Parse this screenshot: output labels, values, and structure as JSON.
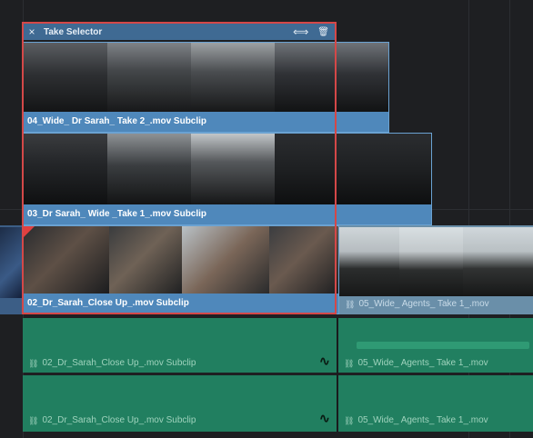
{
  "take_selector": {
    "title": "Take Selector",
    "close_glyph": "×",
    "fit_glyph": "⟺",
    "delete_glyph": "🗑",
    "accent": "#e04040"
  },
  "takes": [
    {
      "label": "04_Wide_ Dr Sarah_ Take 2_.mov Subclip"
    },
    {
      "label": "03_Dr Sarah_ Wide _Take 1_.mov Subclip"
    },
    {
      "label": "02_Dr_Sarah_Close Up_.mov Subclip"
    }
  ],
  "video_track": {
    "next_clip_label": "05_Wide_ Agents_ Take 1_.mov"
  },
  "audio_tracks": [
    {
      "left_label": "02_Dr_Sarah_Close Up_.mov Subclip",
      "right_label": "05_Wide_ Agents_ Take 1_.mov"
    },
    {
      "left_label": "02_Dr_Sarah_Close Up_.mov Subclip",
      "right_label": "05_Wide_ Agents_ Take 1_.mov"
    }
  ],
  "icons": {
    "link_glyph": "⛓",
    "waveform_glyph": "∿"
  },
  "colors": {
    "selected_clip": "#4a80b2",
    "audio": "#217f60",
    "background": "#1e1f22"
  }
}
